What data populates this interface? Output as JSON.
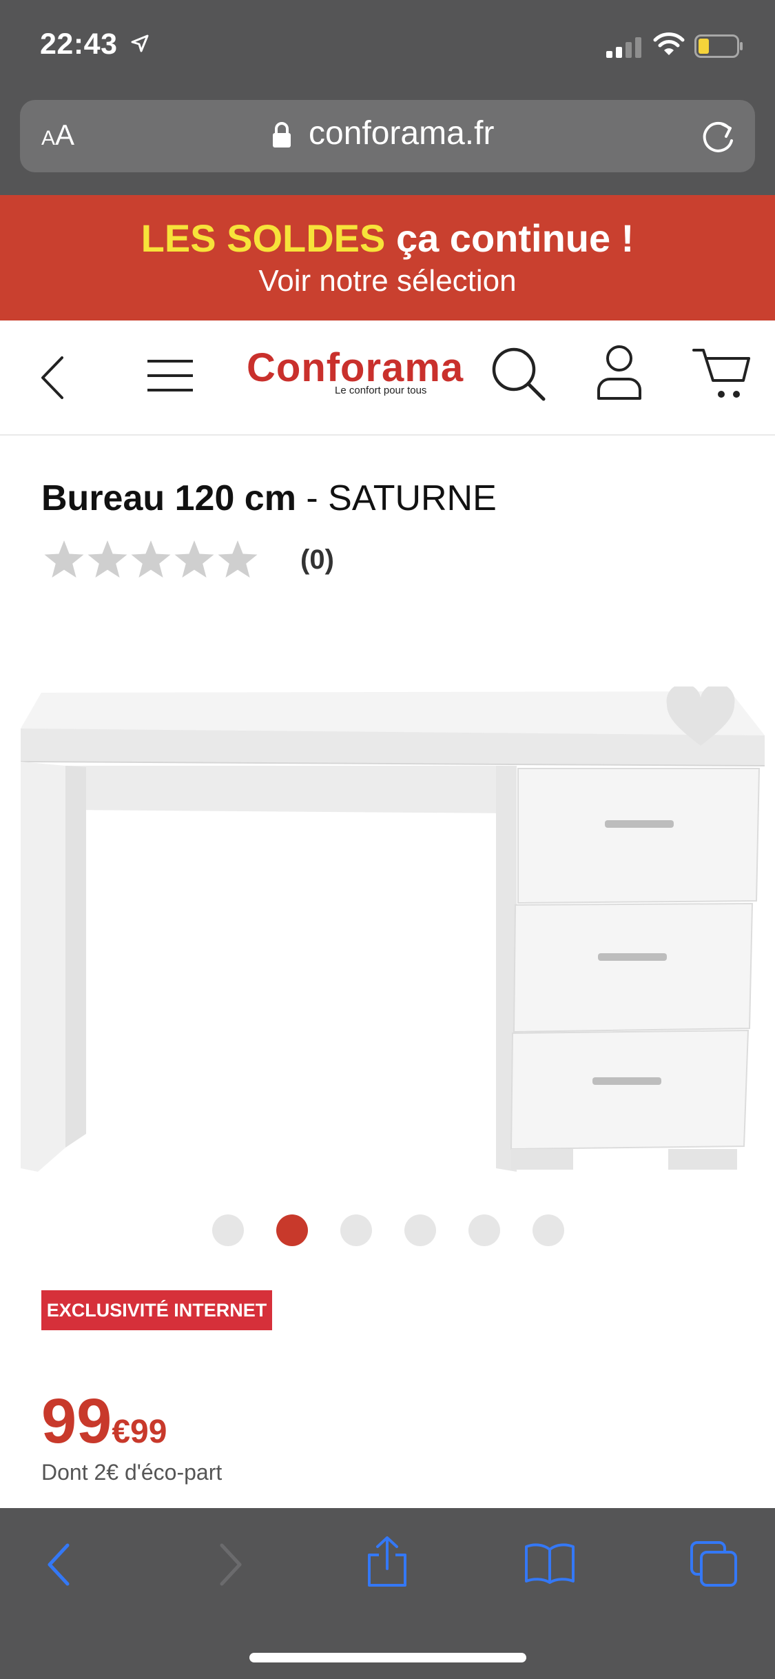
{
  "status_bar": {
    "time": "22:43"
  },
  "browser": {
    "text_size_label": "AA",
    "url": "conforama.fr"
  },
  "promo": {
    "highlight": "LES SOLDES",
    "rest": " ça continue !",
    "subtitle": "Voir notre sélection"
  },
  "header": {
    "logo": "Conforama",
    "tagline": "Le confort pour tous"
  },
  "product": {
    "title_bold": "Bureau 120 cm",
    "title_rest": " - SATURNE",
    "rating": 0,
    "rating_count": "(0)",
    "badge": "EXCLUSIVITÉ INTERNET",
    "price_integer": "99",
    "price_decimal": "€99",
    "eco_part": "Dont 2€ d'éco-part"
  },
  "carousel": {
    "total": 6,
    "active_index": 1
  },
  "colors": {
    "brand_red": "#c9402f",
    "promo_yellow": "#f7e33a",
    "badge_red": "#d6303a",
    "safari_bar": "#555556",
    "ios_blue": "#3478f6"
  }
}
